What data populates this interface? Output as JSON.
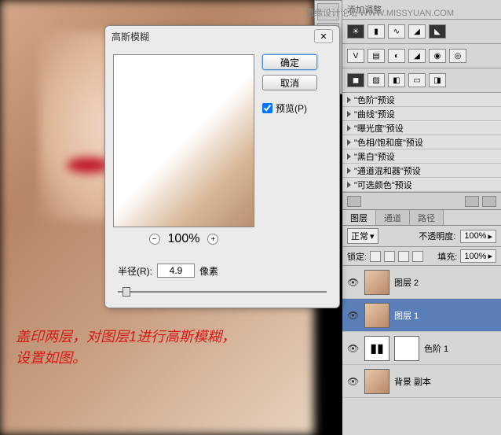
{
  "watermark": "思缘设计论坛  WWW.MISSYUAN.COM",
  "annotation_line1": "盖印两层，对图层1进行高斯模糊，",
  "annotation_line2": "设置如图。",
  "dialog": {
    "title": "高斯模糊",
    "close": "✕",
    "ok": "确定",
    "cancel": "取消",
    "preview_label": "预览(P)",
    "zoom_value": "100%",
    "zoom_minus": "−",
    "zoom_plus": "+",
    "radius_label": "半径(R):",
    "radius_value": "4.9",
    "radius_unit": "像素"
  },
  "adjustments": {
    "header": "添加调整",
    "presets": [
      "\"色阶\"预设",
      "\"曲线\"预设",
      "\"曝光度\"预设",
      "\"色相/饱和度\"预设",
      "\"黑白\"预设",
      "\"通道混和器\"预设",
      "\"可选颜色\"预设"
    ]
  },
  "layers_panel": {
    "tabs": [
      "图层",
      "通道",
      "路径"
    ],
    "blend_mode": "正常",
    "opacity_label": "不透明度:",
    "opacity_value": "100%",
    "lock_label": "锁定:",
    "fill_label": "填充:",
    "fill_value": "100%",
    "layers": [
      {
        "name": "图层 2",
        "visible": true,
        "selected": false,
        "type": "image"
      },
      {
        "name": "图层 1",
        "visible": true,
        "selected": true,
        "type": "image"
      },
      {
        "name": "色阶 1",
        "visible": true,
        "selected": false,
        "type": "levels"
      },
      {
        "name": "背景 副本",
        "visible": true,
        "selected": false,
        "type": "image"
      }
    ]
  }
}
